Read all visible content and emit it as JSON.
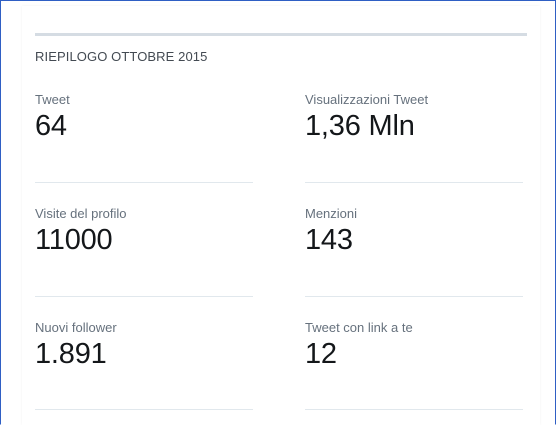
{
  "summary": {
    "title": "RIEPILOGO OTTOBRE 2015"
  },
  "stats": [
    {
      "label": "Tweet",
      "value": "64"
    },
    {
      "label": "Visualizzazioni Tweet",
      "value": "1,36 Mln"
    },
    {
      "label": "Visite del profilo",
      "value": "11000"
    },
    {
      "label": "Menzioni",
      "value": "143"
    },
    {
      "label": "Nuovi follower",
      "value": "1.891"
    },
    {
      "label": "Tweet con link a te",
      "value": "12"
    }
  ],
  "colors": {
    "frame_border": "#2f5fc4",
    "rule": "#d5dce3",
    "label_text": "#66717d",
    "value_text": "#14171a"
  }
}
